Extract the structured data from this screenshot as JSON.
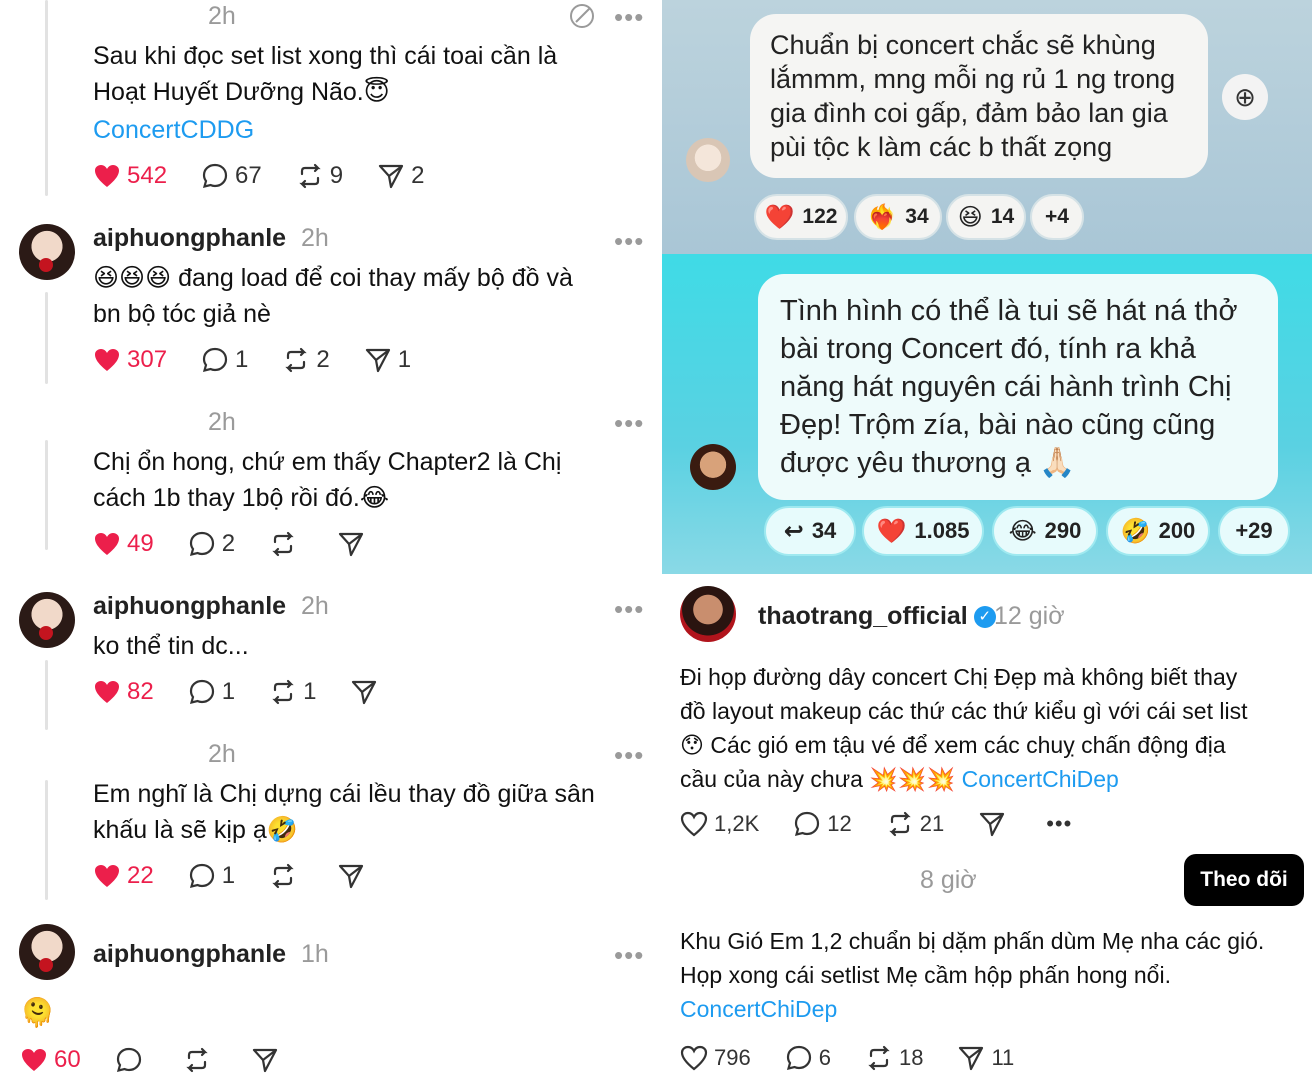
{
  "left": {
    "post1": {
      "time": "2h",
      "text_line1": "Sau khi đọc set list xong thì cái toai cần là",
      "text_line2": "Hoạt Huyết Dưỡng Não.😇",
      "tag": "ConcertCDDG",
      "likes": "542",
      "replies": "67",
      "reposts": "9",
      "shares": "2"
    },
    "post2": {
      "username": "aiphuongphanle",
      "time": "2h",
      "text_line1": "😆😆😆 đang load để coi thay mấy bộ đồ và",
      "text_line2": "bn bộ tóc giả nè",
      "likes": "307",
      "replies": "1",
      "reposts": "2",
      "shares": "1"
    },
    "post3": {
      "time": "2h",
      "text_line1": "Chị ổn hong, chứ em thấy Chapter2 là Chị",
      "text_line2": "cách 1b thay 1bộ rồi đó.😂",
      "likes": "49",
      "replies": "2"
    },
    "post4": {
      "username": "aiphuongphanle",
      "time": "2h",
      "text_line1": "ko thể tin dc...",
      "likes": "82",
      "replies": "1",
      "reposts": "1"
    },
    "post5": {
      "time": "2h",
      "text_line1": "Em nghĩ là Chị dựng cái lều thay đồ giữa sân",
      "text_line2": "khấu là sẽ kịp ạ🤣",
      "likes": "22",
      "replies": "1"
    },
    "post6": {
      "username": "aiphuongphanle",
      "time": "1h",
      "emoji": "🫠",
      "likes": "60"
    }
  },
  "right": {
    "message1": {
      "line1": "Chuẩn bị concert chắc sẽ khùng",
      "line2": "lắmmm, mng mỗi ng rủ 1 ng trong",
      "line3": "gia đình coi gấp, đảm bảo lan gia",
      "line4": "pùi tộc k làm các b thất zọng",
      "reactions": [
        {
          "emoji": "❤️",
          "count": "122"
        },
        {
          "emoji": "❤️‍🔥",
          "count": "34"
        },
        {
          "emoji": "😆",
          "count": "14"
        }
      ],
      "more": "+4"
    },
    "message2": {
      "line1": "Tình hình có thể là tui sẽ hát ná thở",
      "line2": "bài trong Concert đó, tính ra khả",
      "line3": "năng hát nguyên cái hành trình Chị",
      "line4": "Đẹp! Trộm zía, bài nào cũng cũng",
      "line5": "được yêu thương ạ 🙏🏻",
      "reply_count": "34",
      "reactions": [
        {
          "emoji": "❤️",
          "count": "1.085"
        },
        {
          "emoji": "😂",
          "count": "290"
        },
        {
          "emoji": "🤣",
          "count": "200"
        }
      ],
      "more": "+29"
    },
    "post": {
      "username": "thaotrang_official",
      "time": "12 giờ",
      "line1": "Đi họp đường dây concert Chị Đẹp mà không biết thay",
      "line2": "đồ layout makeup các thứ các thứ kiểu gì với cái set list",
      "line3": "😯 Các gió em tậu vé để xem các chuỵ chấn động địa",
      "line4_text": "cầu của này chưa 💥💥💥",
      "tag": "ConcertChiDep",
      "likes": "1,2K",
      "replies": "12",
      "reposts": "21"
    },
    "reply": {
      "time": "8 giờ",
      "follow_label": "Theo dõi",
      "line1": "Khu Gió Em 1,2 chuẩn bị dặm phấn dùm Mẹ nha các gió.",
      "line2": "Họp xong cái setlist Mẹ cầm hộp phấn hong nổi.",
      "tag": "ConcertChiDep",
      "likes": "796",
      "replies": "6",
      "reposts": "18",
      "shares": "11"
    }
  },
  "colors": {
    "like": "#ec1f4b",
    "link": "#1d9bf0",
    "follow_bg": "#000000"
  }
}
